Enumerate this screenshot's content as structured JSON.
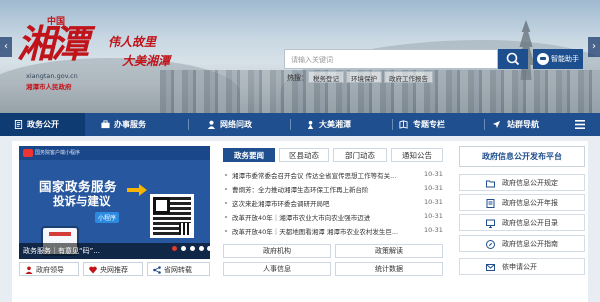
{
  "header": {
    "logo_zhong": "中国",
    "logo_main": "湘潭",
    "domain": "xiangtan.gov.cn",
    "org": "湘潭市人民政府",
    "slogan_line1": "伟人故里",
    "slogan_line2": "大美湘潭",
    "search": {
      "placeholder": "请输入关键词"
    },
    "smart_assistant": "智能助手",
    "hot_label": "热搜：",
    "hot_items": [
      "税务登记",
      "环境保护",
      "政府工作报告"
    ],
    "left_arrow": "‹",
    "right_arrow": "›"
  },
  "nav": {
    "items": [
      {
        "label": "政务公开",
        "icon": "document-icon"
      },
      {
        "label": "办事服务",
        "icon": "briefcase-icon"
      },
      {
        "label": "网络问政",
        "icon": "person-icon"
      },
      {
        "label": "大美湘潭",
        "icon": "tourism-icon"
      },
      {
        "label": "专题专栏",
        "icon": "topics-icon"
      },
      {
        "label": "站群导航",
        "icon": "navigation-icon"
      }
    ],
    "more_icon": "menu-icon"
  },
  "carousel": {
    "top_sub": "国务院客户端小程序",
    "title_line1": "国家政务服务",
    "title_line2": "投诉与建议",
    "badge": "小程序",
    "caption": "政务服务｜有意见“码”...",
    "dots": 5,
    "active_dot": 0
  },
  "quick_links": [
    {
      "label": "政府领导",
      "icon": "leader-icon"
    },
    {
      "label": "央网推荐",
      "icon": "heart-icon"
    },
    {
      "label": "省网转载",
      "icon": "share-icon"
    }
  ],
  "news": {
    "tabs": [
      "政务要闻",
      "区县动态",
      "部门动态",
      "通知公告"
    ],
    "active_tab": 0,
    "items": [
      {
        "title": "湘潭市委常委会召开会议 传达全省宣传思想工作等有关...",
        "date": "10-31"
      },
      {
        "title": "曹炯芳：全力推动湘潭生态环保工作再上新台阶",
        "date": "10-31"
      },
      {
        "title": "这次来赴湘潭市环委会调研开局吧",
        "date": "10-31"
      },
      {
        "title": "改革开放40年｜湘潭市农业大市向农业强市迈进",
        "date": "10-31"
      },
      {
        "title": "改革开放40年｜天都地图看湘潭 湘潭市农业农村发生巨...",
        "date": "10-31"
      }
    ],
    "grid_buttons": [
      "政府机构",
      "政策解读",
      "人事信息",
      "统计数据"
    ]
  },
  "info_panel": {
    "title": "政府信息公开发布平台",
    "items": [
      {
        "label": "政府信息公开规定",
        "icon": "folder-icon"
      },
      {
        "label": "政府信息公开年报",
        "icon": "report-icon"
      },
      {
        "label": "政府信息公开目录",
        "icon": "monitor-icon"
      },
      {
        "label": "政府信息公开指南",
        "icon": "compass-icon"
      },
      {
        "label": "依申请公开",
        "icon": "mail-icon"
      }
    ]
  },
  "colors": {
    "primary": "#1f4f8e",
    "accent": "#c0141a",
    "dark_nav": "#0f3b73"
  }
}
